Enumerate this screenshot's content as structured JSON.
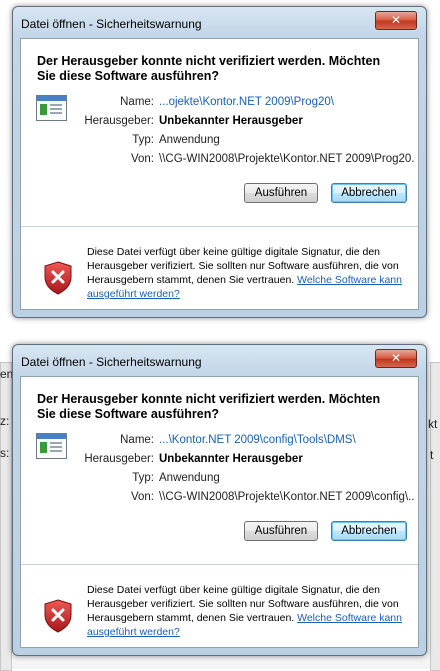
{
  "dialogs": [
    {
      "title": "Datei öffnen - Sicherheitswarnung",
      "close_glyph": "✕",
      "heading": "Der Herausgeber konnte nicht verifiziert werden. Möchten Sie diese Software ausführen?",
      "labels": {
        "name": "Name:",
        "publisher": "Herausgeber:",
        "type": "Typ:",
        "from": "Von:"
      },
      "values": {
        "name": "...ojekte\\Kontor.NET 2009\\Prog20\\",
        "publisher": "Unbekannter Herausgeber",
        "type": "Anwendung",
        "from": "\\\\CG-WIN2008\\Projekte\\Kontor.NET 2009\\Prog20..."
      },
      "buttons": {
        "run": "Ausführen",
        "cancel": "Abbrechen"
      },
      "warning_text": "Diese Datei verfügt über keine gültige digitale Signatur, die den Herausgeber verifiziert. Sie sollten nur Software ausführen, die von Herausgebern stammt, denen Sie vertrauen. ",
      "warning_link": "Welche Software kann ausgeführt werden?"
    },
    {
      "title": "Datei öffnen - Sicherheitswarnung",
      "close_glyph": "✕",
      "heading": "Der Herausgeber konnte nicht verifiziert werden. Möchten Sie diese Software ausführen?",
      "labels": {
        "name": "Name:",
        "publisher": "Herausgeber:",
        "type": "Typ:",
        "from": "Von:"
      },
      "values": {
        "name": "...\\Kontor.NET 2009\\config\\Tools\\DMS\\",
        "publisher": "Unbekannter Herausgeber",
        "type": "Anwendung",
        "from": "\\\\CG-WIN2008\\Projekte\\Kontor.NET 2009\\config\\..."
      },
      "buttons": {
        "run": "Ausführen",
        "cancel": "Abbrechen"
      },
      "warning_text": "Diese Datei verfügt über keine gültige digitale Signatur, die den Herausgeber verifiziert. Sie sollten nur Software ausführen, die von Herausgebern stammt, denen Sie vertrauen. ",
      "warning_link": "Welche Software kann ausgeführt werden?"
    }
  ],
  "background_fragments": {
    "left_top": "en",
    "left_mid": "z:",
    "left_low": "s:",
    "right_top": "kt",
    "right_mid": "t"
  },
  "icons": {
    "app": "application-window-icon",
    "shield": "security-shield-icon",
    "close": "close-icon"
  },
  "colors": {
    "link": "#1a5fb4",
    "close_button": "#c0391f",
    "shield_red": "#c8252b",
    "title_gradient": "#c3d6e8"
  }
}
